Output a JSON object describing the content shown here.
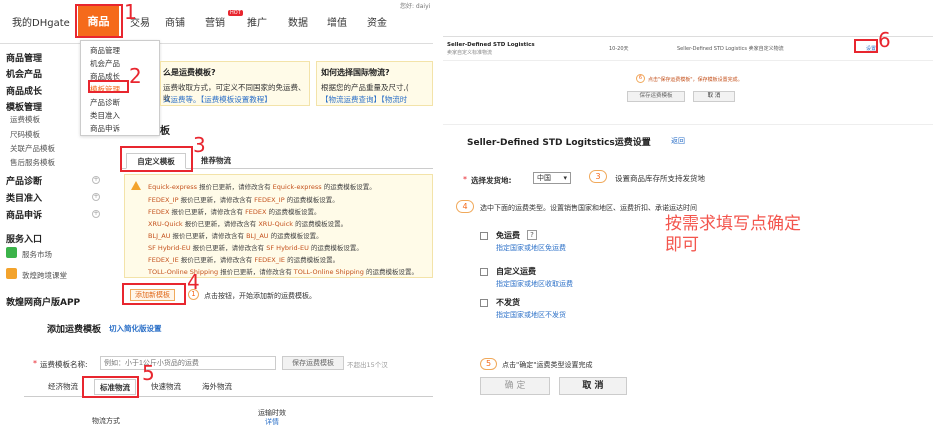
{
  "top_nav": {
    "my_dhgate": "我的DHgate",
    "goods": "商品",
    "trade": "交易",
    "shop": "商铺",
    "marketing": "营销",
    "hot_badge": "HOT",
    "promotion": "推广",
    "data": "数据",
    "value_added": "增值",
    "funds": "资金",
    "user_text": "您好: daiyi"
  },
  "sidebar": {
    "goods_mgmt": "商品管理",
    "opportunity": "机会产品",
    "growth": "商品成长",
    "template_mgmt": "模板管理",
    "freight_template": "运费模板",
    "size_template": "尺码模板",
    "related_template": "关联产品模板",
    "aftersale_template": "售后服务模板",
    "diagnosis": "产品诊断",
    "category": "类目准入",
    "appeal": "商品申诉",
    "service_entry": "服务入口",
    "service_market": "服务市场",
    "learning": "敦煌跨境课堂",
    "app": "敦煌网商户版APP"
  },
  "dropdown": {
    "items": [
      "商品管理",
      "机会产品",
      "商品成长",
      "模板管理",
      "产品诊断",
      "类目准入",
      "商品申诉"
    ]
  },
  "tips": {
    "left_title": "么是运费模板?",
    "left_line1": "运费收取方式，可定义不同国家的免运费、收",
    "left_line2": "义运费等。【运费模板设置教程】",
    "right_title": "如何选择国际物流?",
    "right_line1": "根据您的产品重量及尺寸,(",
    "right_line2": "【物流运费查询】【物流时"
  },
  "section_title": "板",
  "tabs": {
    "custom": "自定义模板",
    "recommended": "推荐物流"
  },
  "warnings": [
    {
      "name": "Equick-express",
      "mid": " 报价已更新，请修改含有 ",
      "tail": " 的运费模板设置。"
    },
    {
      "name": "FEDEX_IP",
      "mid": " 报价已更新，请修改含有 ",
      "tail": " 的运费模板设置。"
    },
    {
      "name": "FEDEX",
      "mid": " 报价已更新，请修改含有 ",
      "tail": " 的运费模板设置。"
    },
    {
      "name": "XRU-Quick",
      "mid": " 报价已更新，请修改含有 ",
      "tail": " 的运费模板设置。"
    },
    {
      "name": "BLJ_AU",
      "mid": " 报价已更新，请修改含有 ",
      "tail": " 的运费模板设置。"
    },
    {
      "name": "SF Hybrid-EU",
      "mid": " 报价已更新，请修改含有 ",
      "tail": " 的运费模板设置。"
    },
    {
      "name": "FEDEX_IE",
      "mid": " 报价已更新，请修改含有 ",
      "tail": " 的运费模板设置。"
    },
    {
      "name": "TOLL-Online Shipping",
      "mid": " 报价已更新，请修改含有 ",
      "tail": " 的运费模板设置。"
    }
  ],
  "add_template": {
    "button": "添加新模板",
    "step_num": "1",
    "hint": "点击按钮，开始添加新的运费模板。"
  },
  "add_panel": {
    "title": "添加运费模板",
    "switch_link": "切入简化版设置",
    "name_label": "运费模板名称:",
    "name_placeholder": "例如：小于1公斤小货品的运费",
    "save_btn": "保存运费模板",
    "limit_text": "不超出15个汉",
    "tabs": [
      "经济物流",
      "标准物流",
      "快速物流",
      "海外物流"
    ],
    "col_method": "物流方式",
    "col_time": "运输时效",
    "col_time_link": "详情"
  },
  "red_numbers": [
    "1",
    "2",
    "3",
    "4",
    "5",
    "6"
  ],
  "top_right": {
    "logistics_name": "Seller-Defined STD Logistics",
    "logistics_sub": "卖家自定义标准物流",
    "days": "10-20天",
    "desc": "Seller-Defined STD Logistics 卖家自定义物流",
    "setting_link": "设置",
    "step_num": "6",
    "hint": "点击\"保存运费模板\"，保存模板设置完成。",
    "save_btn": "保存运费模板",
    "cancel_btn": "取 消"
  },
  "bottom_right": {
    "title": "Seller-Defined STD Logitstics运费设置",
    "back": "返回",
    "select_label": "选择发货地:",
    "select_value": "中国",
    "step3": "3",
    "step3_hint": "设置商品库存所支持发货地",
    "step4": "4",
    "step4_hint": "选中下面的运费类型。设置销售国家和地区、运费折扣、承诺运达时间",
    "opt1": "免运费",
    "opt1_help": "?",
    "opt1_link": "指定国家或地区免运费",
    "opt2": "自定义运费",
    "opt2_link": "指定国家或地区收取运费",
    "opt3": "不发货",
    "opt3_link": "指定国家或地区不发货",
    "note_line1": "按需求填写点确定",
    "note_line2": "即可",
    "step5": "5",
    "step5_hint": "点击\"确定\"运费类型设置完成",
    "confirm_btn": "确 定",
    "cancel_btn": "取 消"
  }
}
